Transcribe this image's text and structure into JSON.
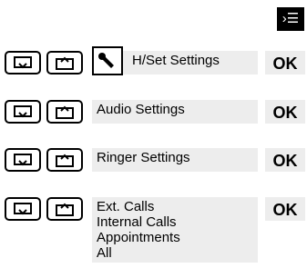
{
  "menu_key_glyph": "›☰",
  "rows": [
    {
      "label": "H/Set Settings",
      "ok": "OK"
    },
    {
      "label": "Audio Settings",
      "ok": "OK"
    },
    {
      "label": "Ringer Settings",
      "ok": "OK"
    },
    {
      "ok": "OK",
      "lines": [
        "Ext. Calls",
        "Internal Calls",
        "Appointments",
        "All"
      ]
    }
  ]
}
